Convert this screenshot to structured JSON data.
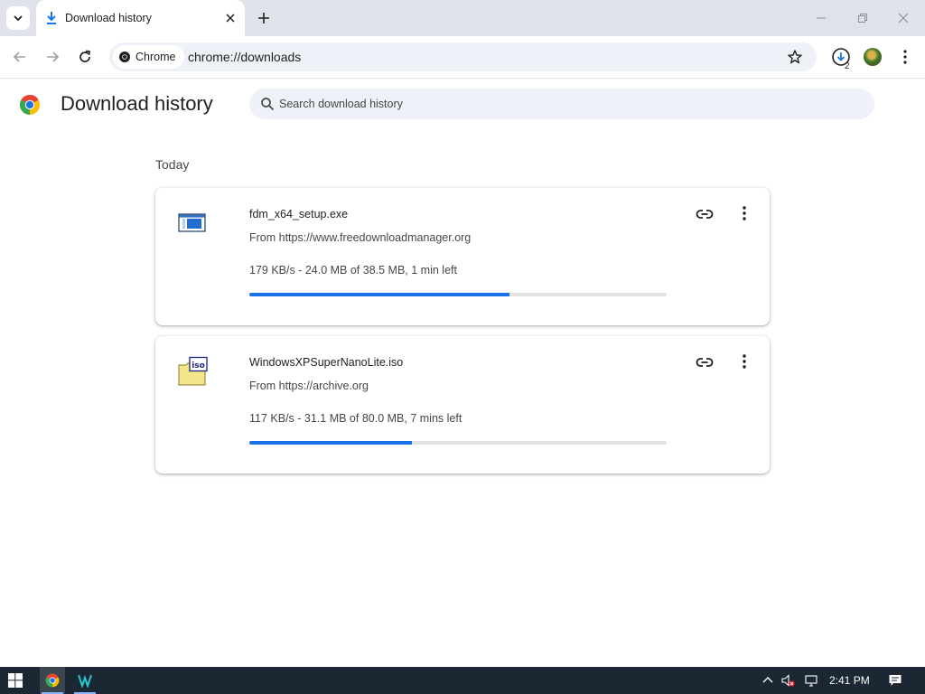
{
  "tab": {
    "title": "Download history"
  },
  "toolbar": {
    "chip_label": "Chrome",
    "url": "chrome://downloads",
    "downloads_count": "2"
  },
  "page": {
    "title": "Download history",
    "search_placeholder": "Search download history",
    "section": "Today"
  },
  "downloads": [
    {
      "name": "fdm_x64_setup.exe",
      "source": "From https://www.freedownloadmanager.org",
      "status": "179 KB/s - 24.0 MB of 38.5 MB, 1 min left",
      "progress": 0.623
    },
    {
      "name": "WindowsXPSuperNanoLite.iso",
      "source": "From https://archive.org",
      "status": "117 KB/s - 31.1 MB of 80.0 MB, 7 mins left",
      "progress": 0.389
    }
  ],
  "file_icons": [
    "exe-file-icon",
    "iso-file-icon"
  ],
  "taskbar": {
    "clock": "2:41 PM"
  },
  "colors": {
    "accent": "#1a73e8",
    "tabstrip": "#dfe3e9",
    "omnibox": "#eef2f8",
    "taskbar": "#1b2733"
  }
}
